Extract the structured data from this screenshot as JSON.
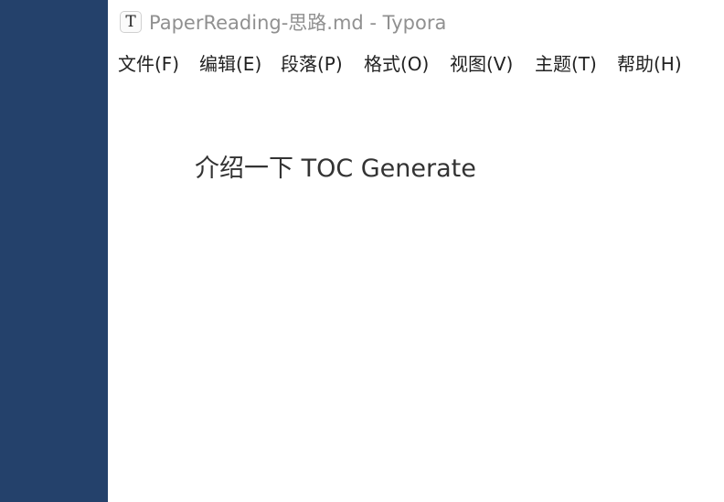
{
  "colors": {
    "left_panel": "#24416b",
    "title_text": "#909090",
    "menu_text": "#222222",
    "editor_text": "#333333",
    "background": "#ffffff"
  },
  "window": {
    "app_icon_glyph": "T",
    "app_icon_name": "typora-app-icon",
    "title": "PaperReading-思路.md - Typora"
  },
  "menu": {
    "file": "文件(F)",
    "edit": "编辑(E)",
    "paragraph": "段落(P)",
    "format": "格式(O)",
    "view": "视图(V)",
    "theme": "主题(T)",
    "help": "帮助(H)"
  },
  "editor": {
    "line_1": "介绍一下 TOC Generate"
  }
}
